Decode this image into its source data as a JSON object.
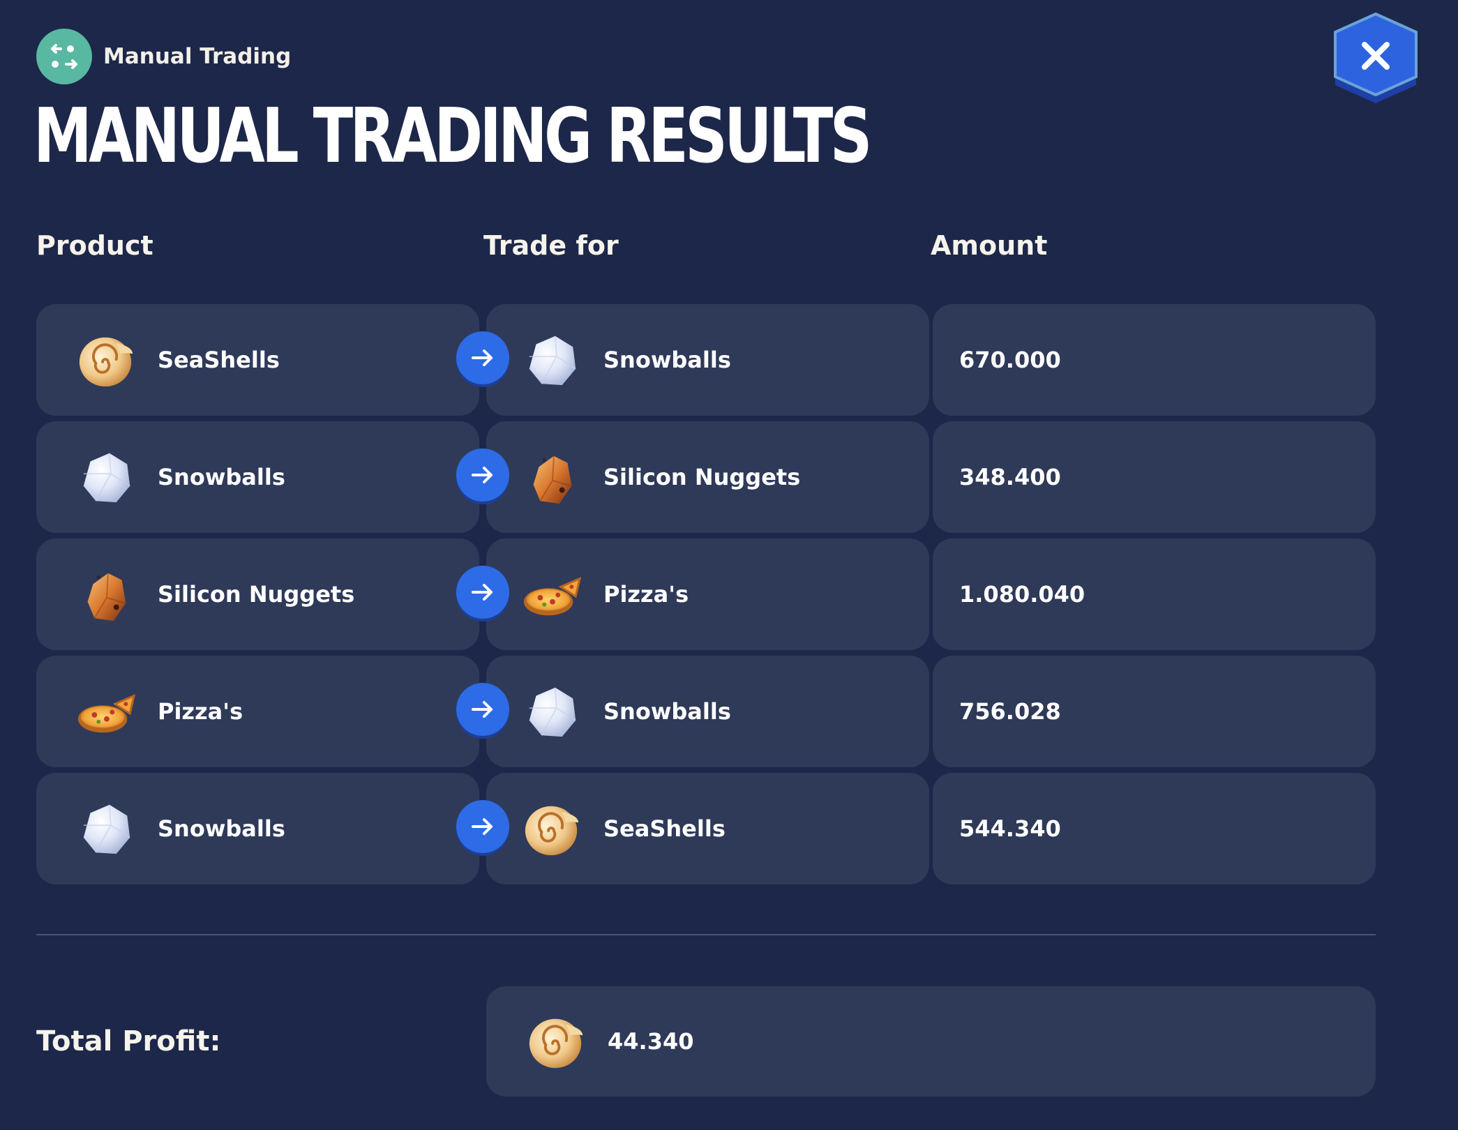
{
  "header": {
    "badge_label": "Manual Trading",
    "badge_icon": "swap-arrows-icon",
    "title": "MANUAL TRADING RESULTS",
    "close_icon": "close-icon"
  },
  "colors": {
    "background": "#1d2749",
    "card": "#2f3a59",
    "accent": "#2e6be6",
    "badge": "#58b8a1"
  },
  "table": {
    "columns": [
      "Product",
      "Trade for",
      "Amount"
    ],
    "rows": [
      {
        "product": "SeaShells",
        "product_icon": "seashell-icon",
        "trade_for": "Snowballs",
        "trade_for_icon": "snowball-icon",
        "amount": "670.000"
      },
      {
        "product": "Snowballs",
        "product_icon": "snowball-icon",
        "trade_for": "Silicon Nuggets",
        "trade_for_icon": "silicon-nugget-icon",
        "amount": "348.400"
      },
      {
        "product": "Silicon Nuggets",
        "product_icon": "silicon-nugget-icon",
        "trade_for": "Pizza's",
        "trade_for_icon": "pizza-icon",
        "amount": "1.080.040"
      },
      {
        "product": "Pizza's",
        "product_icon": "pizza-icon",
        "trade_for": "Snowballs",
        "trade_for_icon": "snowball-icon",
        "amount": "756.028"
      },
      {
        "product": "Snowballs",
        "product_icon": "snowball-icon",
        "trade_for": "SeaShells",
        "trade_for_icon": "seashell-icon",
        "amount": "544.340"
      }
    ]
  },
  "total": {
    "label": "Total Profit:",
    "icon": "seashell-icon",
    "value": "44.340"
  }
}
